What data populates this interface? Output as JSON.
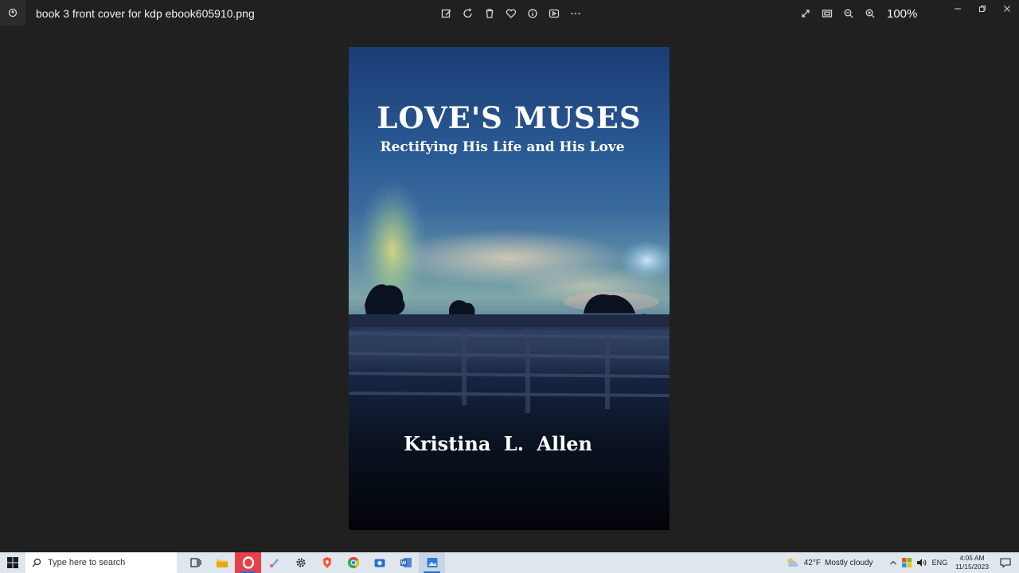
{
  "titlebar": {
    "file_name": "book 3 front cover for kdp ebook605910.png",
    "zoom_level": "100%",
    "tools": [
      "edit-icon",
      "rotate-icon",
      "delete-icon",
      "favorite-icon",
      "info-icon",
      "slideshow-icon",
      "more-icon"
    ],
    "view_tools": [
      "fullscreen-icon",
      "fit-to-window-icon",
      "zoom-out-icon",
      "zoom-in-icon"
    ]
  },
  "cover": {
    "title": "LOVE'S  MUSES",
    "subtitle": "Rectifying His Life and His Love",
    "author": "Kristina L. Allen"
  },
  "taskbar": {
    "search_placeholder": "Type here to search",
    "weather_temp": "42°F",
    "weather_text": "Mostly cloudy",
    "language": "ENG",
    "time": "4:05 AM",
    "date": "11/15/2023"
  },
  "colors": {
    "app_background": "#202020",
    "taskbar_background": "#dfe6ee",
    "accent": "#2a6fc9"
  }
}
